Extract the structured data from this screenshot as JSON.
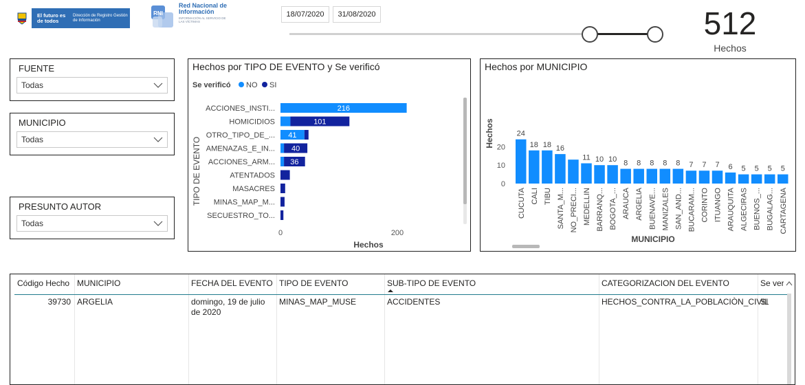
{
  "header": {
    "gov_logo": {
      "line1": "El futuro es de todos",
      "line2": "Dirección de Registro Gestión de Información"
    },
    "rni_logo": {
      "badge": "RNI",
      "title": "Red Nacional de Información",
      "subtitle": "INFORMACIÓN AL SERVICIO DE LAS VÍCTIMAS"
    },
    "date_from": "18/07/2020",
    "date_to": "31/08/2020",
    "date_range_position": {
      "start": 0.82,
      "end": 1.0
    }
  },
  "kpi": {
    "value": "512",
    "label": "Hechos"
  },
  "slicers": [
    {
      "title": "FUENTE",
      "value": "Todas"
    },
    {
      "title": "MUNICIPIO",
      "value": "Todas"
    },
    {
      "title": "PRESUNTO AUTOR",
      "value": "Todas"
    }
  ],
  "chart_data": [
    {
      "type": "bar",
      "orientation": "horizontal",
      "stacked": true,
      "title": "Hechos por TIPO DE EVENTO y Se verificó",
      "legend_title": "Se verificó",
      "legend_position": "top-left",
      "xlabel": "Hechos",
      "ylabel": "TIPO DE EVENTO",
      "xlim": [
        0,
        240
      ],
      "xticks": [
        0,
        200
      ],
      "categories": [
        "ACCIONES_INSTI...",
        "HOMICIDIOS",
        "OTRO_TIPO_DE_...",
        "AMENAZAS_E_IN...",
        "ACCIONES_ARM...",
        "ATENTADOS",
        "MASACRES",
        "MINAS_MAP_M...",
        "SECUESTRO_TO..."
      ],
      "series": [
        {
          "name": "NO",
          "color": "#118dff",
          "values": [
            216,
            17,
            41,
            6,
            6,
            0,
            0,
            0,
            0
          ],
          "labels": [
            "216",
            "",
            "41",
            "",
            "",
            "",
            "",
            "",
            ""
          ]
        },
        {
          "name": "SI",
          "color": "#12239e",
          "values": [
            0,
            101,
            7,
            40,
            36,
            16,
            8,
            7,
            5
          ],
          "labels": [
            "",
            "101",
            "",
            "40",
            "36",
            "",
            "",
            "",
            ""
          ]
        }
      ]
    },
    {
      "type": "bar",
      "title": "Hechos por MUNICIPIO",
      "xlabel": "MUNICIPIO",
      "ylabel": "Hechos",
      "ylim": [
        0,
        26
      ],
      "yticks": [
        0,
        10,
        20
      ],
      "color": "#118dff",
      "categories": [
        "CUCUTA",
        "CALI",
        "TIBU",
        "SANTA_M...",
        "NO_PRECI...",
        "MEDELLIN",
        "BARRANQ...",
        "BOGOTA_...",
        "ARAUCA",
        "ARGELIA",
        "BUENAVE...",
        "MANIZALES",
        "SAN_AND...",
        "BUCARAM...",
        "CORINTO",
        "ITUANGO",
        "ARAUQUITA",
        "ALGECIRAS",
        "BUENOS_...",
        "BUGALAG...",
        "CARTAGENA"
      ],
      "values": [
        24,
        18,
        18,
        16,
        13,
        11,
        10,
        10,
        8,
        8,
        8,
        8,
        8,
        7,
        7,
        7,
        6,
        5,
        5,
        5,
        5
      ],
      "labels": [
        "24",
        "18",
        "18",
        "16",
        "",
        "11",
        "10",
        "10",
        "8",
        "8",
        "8",
        "8",
        "8",
        "7",
        "7",
        "7",
        "6",
        "5",
        "5",
        "5",
        "5"
      ]
    }
  ],
  "table": {
    "columns": [
      "Código Hecho",
      "MUNICIPIO",
      "FECHA DEL EVENTO",
      "TIPO DE EVENTO",
      "SUB-TIPO DE EVENTO",
      "CATEGORIZACION DEL EVENTO",
      "Se verifi"
    ],
    "rows": [
      [
        "39730",
        "ARGELIA",
        "domingo, 19 de julio de 2020",
        "MINAS_MAP_MUSE",
        "ACCIDENTES",
        "HECHOS_CONTRA_LA_POBLACIÒN_CIVIL",
        "SI"
      ]
    ]
  }
}
